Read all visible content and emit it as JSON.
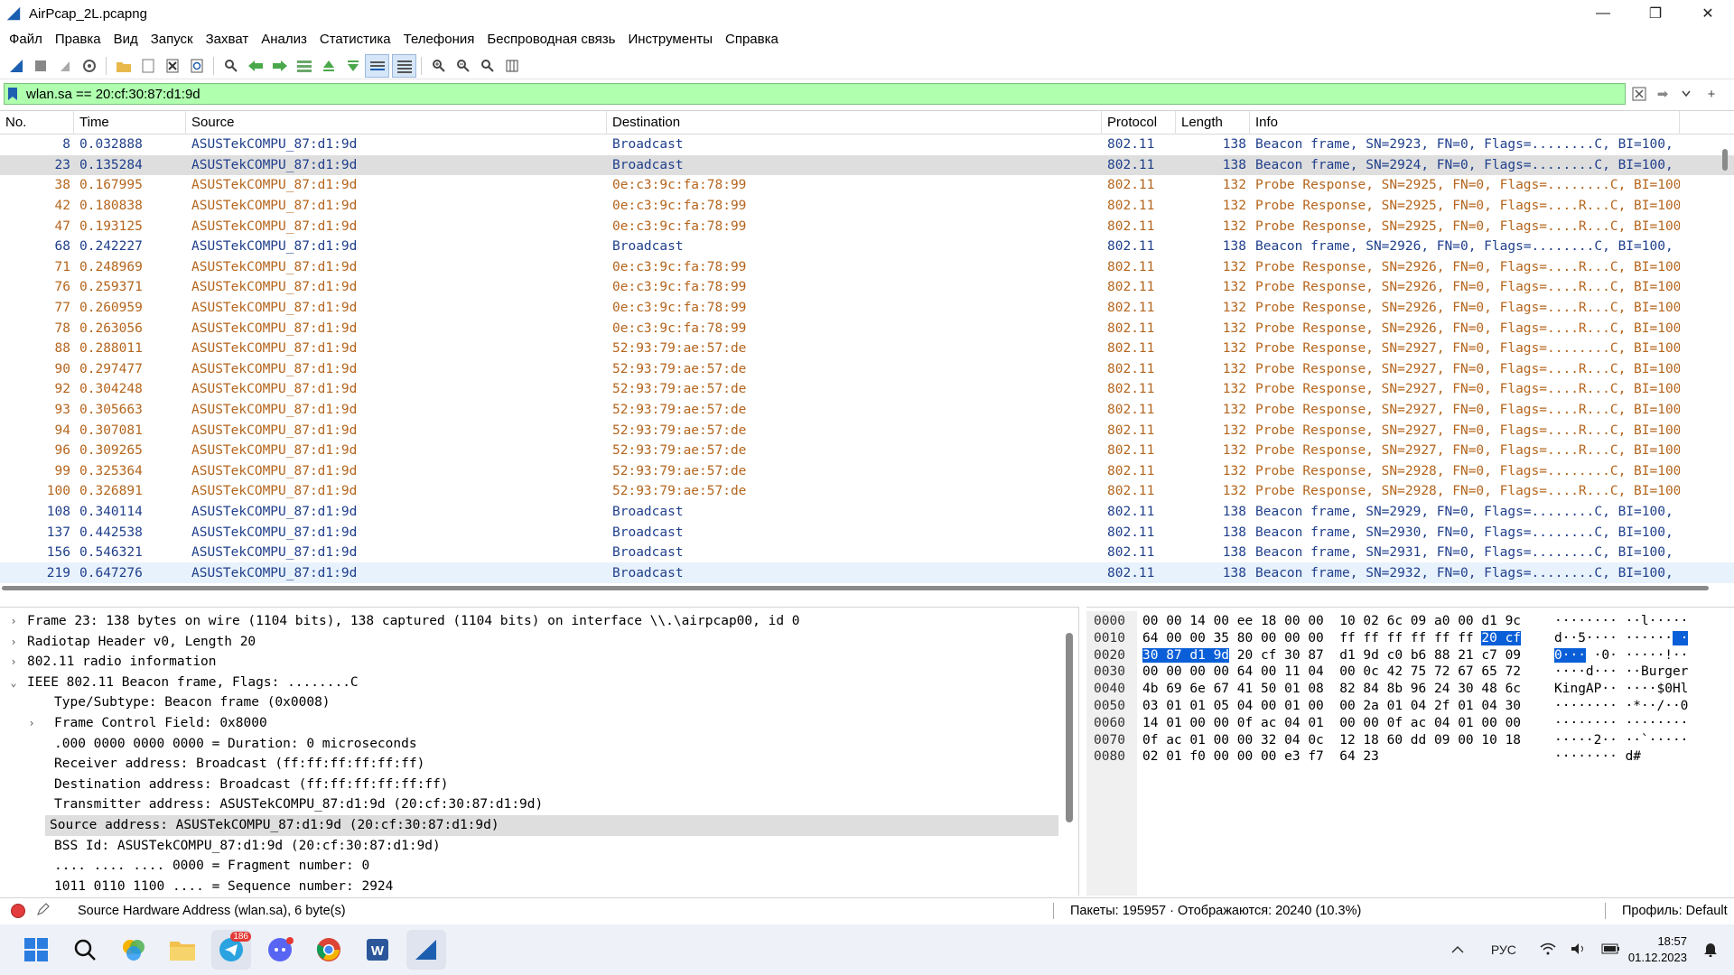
{
  "window": {
    "title": "AirPcap_2L.pcapng",
    "minimize": "—",
    "restore": "❐",
    "close": "✕"
  },
  "menu": [
    "Файл",
    "Правка",
    "Вид",
    "Запуск",
    "Захват",
    "Анализ",
    "Статистика",
    "Телефония",
    "Беспроводная связь",
    "Инструменты",
    "Справка"
  ],
  "filter": {
    "value": "wlan.sa == 20:cf:30:87:d1:9d",
    "apply_glyph": "➡",
    "add_glyph": "+"
  },
  "colors": {
    "filter_ok_bg": "#afffaf",
    "beacon_text": "#1f3f8c",
    "probe_text": "#b5651d",
    "selection": "#dedede",
    "hex_highlight": "#0a5fd8"
  },
  "packet_list": {
    "columns": [
      "No.",
      "Time",
      "Source",
      "Destination",
      "Protocol",
      "Length",
      "Info"
    ],
    "rows": [
      {
        "no": "8",
        "time": "0.032888",
        "src": "ASUSTekCOMPU_87:d1:9d",
        "dst": "Broadcast",
        "proto": "802.11",
        "len": "138",
        "info": "Beacon frame, SN=2923, FN=0, Flags=........C, BI=100,",
        "kind": "beacon"
      },
      {
        "no": "23",
        "time": "0.135284",
        "src": "ASUSTekCOMPU_87:d1:9d",
        "dst": "Broadcast",
        "proto": "802.11",
        "len": "138",
        "info": "Beacon frame, SN=2924, FN=0, Flags=........C, BI=100,",
        "kind": "beacon",
        "state": "selected"
      },
      {
        "no": "38",
        "time": "0.167995",
        "src": "ASUSTekCOMPU_87:d1:9d",
        "dst": "0e:c3:9c:fa:78:99",
        "proto": "802.11",
        "len": "132",
        "info": "Probe Response, SN=2925, FN=0, Flags=........C, BI=100",
        "kind": "probe"
      },
      {
        "no": "42",
        "time": "0.180838",
        "src": "ASUSTekCOMPU_87:d1:9d",
        "dst": "0e:c3:9c:fa:78:99",
        "proto": "802.11",
        "len": "132",
        "info": "Probe Response, SN=2925, FN=0, Flags=....R...C, BI=100",
        "kind": "probe"
      },
      {
        "no": "47",
        "time": "0.193125",
        "src": "ASUSTekCOMPU_87:d1:9d",
        "dst": "0e:c3:9c:fa:78:99",
        "proto": "802.11",
        "len": "132",
        "info": "Probe Response, SN=2925, FN=0, Flags=....R...C, BI=100",
        "kind": "probe"
      },
      {
        "no": "68",
        "time": "0.242227",
        "src": "ASUSTekCOMPU_87:d1:9d",
        "dst": "Broadcast",
        "proto": "802.11",
        "len": "138",
        "info": "Beacon frame, SN=2926, FN=0, Flags=........C, BI=100,",
        "kind": "beacon"
      },
      {
        "no": "71",
        "time": "0.248969",
        "src": "ASUSTekCOMPU_87:d1:9d",
        "dst": "0e:c3:9c:fa:78:99",
        "proto": "802.11",
        "len": "132",
        "info": "Probe Response, SN=2926, FN=0, Flags=....R...C, BI=100",
        "kind": "probe"
      },
      {
        "no": "76",
        "time": "0.259371",
        "src": "ASUSTekCOMPU_87:d1:9d",
        "dst": "0e:c3:9c:fa:78:99",
        "proto": "802.11",
        "len": "132",
        "info": "Probe Response, SN=2926, FN=0, Flags=....R...C, BI=100",
        "kind": "probe"
      },
      {
        "no": "77",
        "time": "0.260959",
        "src": "ASUSTekCOMPU_87:d1:9d",
        "dst": "0e:c3:9c:fa:78:99",
        "proto": "802.11",
        "len": "132",
        "info": "Probe Response, SN=2926, FN=0, Flags=....R...C, BI=100",
        "kind": "probe"
      },
      {
        "no": "78",
        "time": "0.263056",
        "src": "ASUSTekCOMPU_87:d1:9d",
        "dst": "0e:c3:9c:fa:78:99",
        "proto": "802.11",
        "len": "132",
        "info": "Probe Response, SN=2926, FN=0, Flags=....R...C, BI=100",
        "kind": "probe"
      },
      {
        "no": "88",
        "time": "0.288011",
        "src": "ASUSTekCOMPU_87:d1:9d",
        "dst": "52:93:79:ae:57:de",
        "proto": "802.11",
        "len": "132",
        "info": "Probe Response, SN=2927, FN=0, Flags=........C, BI=100",
        "kind": "probe"
      },
      {
        "no": "90",
        "time": "0.297477",
        "src": "ASUSTekCOMPU_87:d1:9d",
        "dst": "52:93:79:ae:57:de",
        "proto": "802.11",
        "len": "132",
        "info": "Probe Response, SN=2927, FN=0, Flags=....R...C, BI=100",
        "kind": "probe"
      },
      {
        "no": "92",
        "time": "0.304248",
        "src": "ASUSTekCOMPU_87:d1:9d",
        "dst": "52:93:79:ae:57:de",
        "proto": "802.11",
        "len": "132",
        "info": "Probe Response, SN=2927, FN=0, Flags=....R...C, BI=100",
        "kind": "probe"
      },
      {
        "no": "93",
        "time": "0.305663",
        "src": "ASUSTekCOMPU_87:d1:9d",
        "dst": "52:93:79:ae:57:de",
        "proto": "802.11",
        "len": "132",
        "info": "Probe Response, SN=2927, FN=0, Flags=....R...C, BI=100",
        "kind": "probe"
      },
      {
        "no": "94",
        "time": "0.307081",
        "src": "ASUSTekCOMPU_87:d1:9d",
        "dst": "52:93:79:ae:57:de",
        "proto": "802.11",
        "len": "132",
        "info": "Probe Response, SN=2927, FN=0, Flags=....R...C, BI=100",
        "kind": "probe"
      },
      {
        "no": "96",
        "time": "0.309265",
        "src": "ASUSTekCOMPU_87:d1:9d",
        "dst": "52:93:79:ae:57:de",
        "proto": "802.11",
        "len": "132",
        "info": "Probe Response, SN=2927, FN=0, Flags=....R...C, BI=100",
        "kind": "probe"
      },
      {
        "no": "99",
        "time": "0.325364",
        "src": "ASUSTekCOMPU_87:d1:9d",
        "dst": "52:93:79:ae:57:de",
        "proto": "802.11",
        "len": "132",
        "info": "Probe Response, SN=2928, FN=0, Flags=........C, BI=100",
        "kind": "probe"
      },
      {
        "no": "100",
        "time": "0.326891",
        "src": "ASUSTekCOMPU_87:d1:9d",
        "dst": "52:93:79:ae:57:de",
        "proto": "802.11",
        "len": "132",
        "info": "Probe Response, SN=2928, FN=0, Flags=....R...C, BI=100",
        "kind": "probe"
      },
      {
        "no": "108",
        "time": "0.340114",
        "src": "ASUSTekCOMPU_87:d1:9d",
        "dst": "Broadcast",
        "proto": "802.11",
        "len": "138",
        "info": "Beacon frame, SN=2929, FN=0, Flags=........C, BI=100,",
        "kind": "beacon"
      },
      {
        "no": "137",
        "time": "0.442538",
        "src": "ASUSTekCOMPU_87:d1:9d",
        "dst": "Broadcast",
        "proto": "802.11",
        "len": "138",
        "info": "Beacon frame, SN=2930, FN=0, Flags=........C, BI=100,",
        "kind": "beacon"
      },
      {
        "no": "156",
        "time": "0.546321",
        "src": "ASUSTekCOMPU_87:d1:9d",
        "dst": "Broadcast",
        "proto": "802.11",
        "len": "138",
        "info": "Beacon frame, SN=2931, FN=0, Flags=........C, BI=100,",
        "kind": "beacon"
      },
      {
        "no": "219",
        "time": "0.647276",
        "src": "ASUSTekCOMPU_87:d1:9d",
        "dst": "Broadcast",
        "proto": "802.11",
        "len": "138",
        "info": "Beacon frame, SN=2932, FN=0, Flags=........C, BI=100,",
        "kind": "beacon",
        "state": "hover"
      }
    ]
  },
  "details": [
    {
      "text": "Frame 23: 138 bytes on wire (1104 bits), 138 captured (1104 bits) on interface \\\\.\\airpcap00, id 0",
      "level": 0,
      "arrow": "›"
    },
    {
      "text": "Radiotap Header v0, Length 20",
      "level": 0,
      "arrow": "›"
    },
    {
      "text": "802.11 radio information",
      "level": 0,
      "arrow": "›"
    },
    {
      "text": "IEEE 802.11 Beacon frame, Flags: ........C",
      "level": 0,
      "arrow": "⌄"
    },
    {
      "text": "Type/Subtype: Beacon frame (0x0008)",
      "level": 1,
      "arrow": ""
    },
    {
      "text": "Frame Control Field: 0x8000",
      "level": 1,
      "arrow": "›"
    },
    {
      "text": ".000 0000 0000 0000 = Duration: 0 microseconds",
      "level": 1,
      "arrow": ""
    },
    {
      "text": "Receiver address: Broadcast (ff:ff:ff:ff:ff:ff)",
      "level": 1,
      "arrow": ""
    },
    {
      "text": "Destination address: Broadcast (ff:ff:ff:ff:ff:ff)",
      "level": 1,
      "arrow": ""
    },
    {
      "text": "Transmitter address: ASUSTekCOMPU_87:d1:9d (20:cf:30:87:d1:9d)",
      "level": 1,
      "arrow": ""
    },
    {
      "text": "Source address: ASUSTekCOMPU_87:d1:9d (20:cf:30:87:d1:9d)",
      "level": 1,
      "arrow": "",
      "selected": true
    },
    {
      "text": "BSS Id: ASUSTekCOMPU_87:d1:9d (20:cf:30:87:d1:9d)",
      "level": 1,
      "arrow": ""
    },
    {
      "text": ".... .... .... 0000 = Fragment number: 0",
      "level": 1,
      "arrow": ""
    },
    {
      "text": "1011 0110 1100 .... = Sequence number: 2924",
      "level": 1,
      "arrow": ""
    }
  ],
  "bytes": [
    {
      "off": "0000",
      "pre": "00 00 14 00 ee 18 00 00  10 02 6c 09 a0 00 d1 9c",
      "hl": "",
      "post": "",
      "a_pre": "········ ··l·····",
      "a_hl": "",
      "a_post": ""
    },
    {
      "off": "0010",
      "pre": "64 00 00 35 80 00 00 00  ff ff ff ff ff ff ",
      "hl": "20 cf",
      "post": "",
      "a_pre": "d··5···· ······",
      "a_hl": " ·",
      "a_post": ""
    },
    {
      "off": "0020",
      "pre": "",
      "hl": "30 87 d1 9d",
      "post": " 20 cf 30 87  d1 9d c0 b6 88 21 c7 09",
      "a_pre": "",
      "a_hl": "0···",
      "a_post": " ·0· ·····!··"
    },
    {
      "off": "0030",
      "pre": "00 00 00 00 64 00 11 04  00 0c 42 75 72 67 65 72",
      "hl": "",
      "post": "",
      "a_pre": "····d··· ··Burger",
      "a_hl": "",
      "a_post": ""
    },
    {
      "off": "0040",
      "pre": "4b 69 6e 67 41 50 01 08  82 84 8b 96 24 30 48 6c",
      "hl": "",
      "post": "",
      "a_pre": "KingAP·· ····$0Hl",
      "a_hl": "",
      "a_post": ""
    },
    {
      "off": "0050",
      "pre": "03 01 01 05 04 00 01 00  00 2a 01 04 2f 01 04 30",
      "hl": "",
      "post": "",
      "a_pre": "········ ·*··/··0",
      "a_hl": "",
      "a_post": ""
    },
    {
      "off": "0060",
      "pre": "14 01 00 00 0f ac 04 01  00 00 0f ac 04 01 00 00",
      "hl": "",
      "post": "",
      "a_pre": "········ ········",
      "a_hl": "",
      "a_post": ""
    },
    {
      "off": "0070",
      "pre": "0f ac 01 00 00 32 04 0c  12 18 60 dd 09 00 10 18",
      "hl": "",
      "post": "",
      "a_pre": "·····2·· ··`·····",
      "a_hl": "",
      "a_post": ""
    },
    {
      "off": "0080",
      "pre": "02 01 f0 00 00 00 e3 f7  64 23",
      "hl": "",
      "post": "",
      "a_pre": "········ d#",
      "a_hl": "",
      "a_post": ""
    }
  ],
  "status": {
    "field_info": "Source Hardware Address (wlan.sa), 6 byte(s)",
    "packets": "Пакеты: 195957 · Отображаются: 20240 (10.3%)",
    "profile": "Профиль: Default"
  },
  "taskbar": {
    "apps": [
      "start-icon",
      "search-icon",
      "photos-icon",
      "file-explorer-icon",
      "telegram-icon",
      "discord-icon",
      "chrome-icon",
      "word-icon",
      "wireshark-icon"
    ],
    "telegram_badge": "186",
    "language": "РУС",
    "time": "18:57",
    "date": "01.12.2023"
  }
}
